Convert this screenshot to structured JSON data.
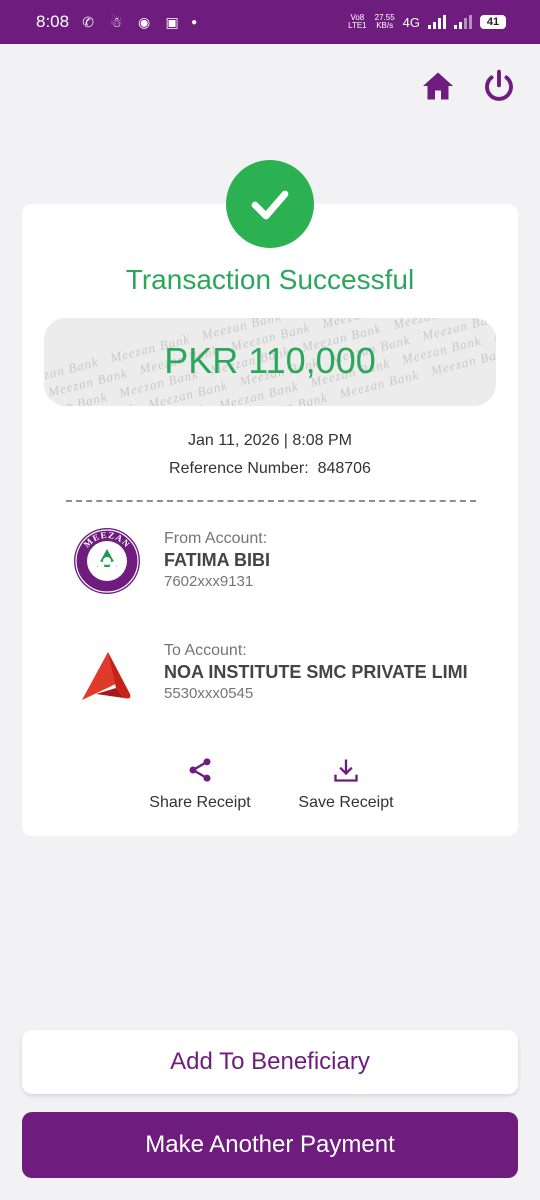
{
  "status_bar": {
    "time": "8:08",
    "network_speed_value": "27.55",
    "network_speed_unit": "KB/s",
    "volte_top": "Vo8",
    "volte_bottom": "LTE1",
    "network_type": "4G",
    "battery": "41"
  },
  "header": {
    "home_icon": "home-icon",
    "power_icon": "power-icon"
  },
  "receipt": {
    "title": "Transaction Successful",
    "amount": "PKR 110,000",
    "watermark_text": "Meezan Bank",
    "datetime": "Jan 11, 2026 | 8:08 PM",
    "reference_label": "Reference Number:",
    "reference_number": "848706",
    "from": {
      "label": "From Account:",
      "name": "FATIMA BIBI",
      "number": "7602xxx9131",
      "bank_logo_text_top": "MEEZAN",
      "bank_logo_text_bottom": "BANK"
    },
    "to": {
      "label": "To Account:",
      "name": "NOA INSTITUTE SMC PRIVATE LIMI",
      "number": "5530xxx0545"
    },
    "actions": {
      "share_label": "Share Receipt",
      "save_label": "Save Receipt"
    }
  },
  "buttons": {
    "add_beneficiary": "Add To Beneficiary",
    "make_payment": "Make Another Payment"
  },
  "colors": {
    "brand_purple": "#6e1d7e",
    "success_green": "#2aa75a"
  }
}
